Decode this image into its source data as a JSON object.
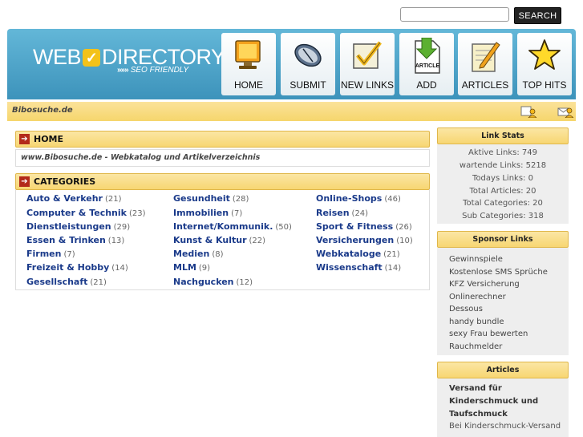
{
  "search": {
    "placeholder": "",
    "button_label": "SEARCH"
  },
  "logo": {
    "left": "WEB",
    "right": "DIRECTORY",
    "tagline_arrows": "»»»",
    "tagline": "SEO FRIENDLY"
  },
  "nav": [
    {
      "label": "HOME",
      "icon": "monitor-icon"
    },
    {
      "label": "SUBMIT",
      "icon": "mouse-icon"
    },
    {
      "label": "NEW LINKS",
      "icon": "checkmark-icon"
    },
    {
      "label": "ADD",
      "icon": "article-download-icon",
      "icon_text": "ARTICLE"
    },
    {
      "label": "ARTICLES",
      "icon": "notepad-pencil-icon"
    },
    {
      "label": "TOP HITS",
      "icon": "star-icon"
    }
  ],
  "site_name": "Bibosuche.de",
  "home_panel": {
    "title": "HOME",
    "text": "www.Bibosuche.de - Webkatalog und Artikelverzeichnis"
  },
  "categories_panel": {
    "title": "CATEGORIES",
    "items": [
      {
        "name": "Auto & Verkehr",
        "count": "(21)"
      },
      {
        "name": "Computer & Technik",
        "count": "(23)"
      },
      {
        "name": "Dienstleistungen",
        "count": "(29)"
      },
      {
        "name": "Essen & Trinken",
        "count": "(13)"
      },
      {
        "name": "Firmen",
        "count": "(7)"
      },
      {
        "name": "Freizeit & Hobby",
        "count": "(14)"
      },
      {
        "name": "Gesellschaft",
        "count": "(21)"
      },
      {
        "name": "Gesundheit",
        "count": "(28)"
      },
      {
        "name": "Immobilien",
        "count": "(7)"
      },
      {
        "name": "Internet/Kommunik.",
        "count": "(50)"
      },
      {
        "name": "Kunst & Kultur",
        "count": "(22)"
      },
      {
        "name": "Medien",
        "count": "(8)"
      },
      {
        "name": "MLM",
        "count": "(9)"
      },
      {
        "name": "Nachgucken",
        "count": "(12)"
      },
      {
        "name": "Online-Shops",
        "count": "(46)"
      },
      {
        "name": "Reisen",
        "count": "(24)"
      },
      {
        "name": "Sport & Fitness",
        "count": "(26)"
      },
      {
        "name": "Versicherungen",
        "count": "(10)"
      },
      {
        "name": "Webkataloge",
        "count": "(21)"
      },
      {
        "name": "Wissenschaft",
        "count": "(14)"
      }
    ]
  },
  "link_stats": {
    "title": "Link Stats",
    "lines": [
      "Aktive Links: 749",
      "wartende Links: 5218",
      "Todays Links: 0",
      "Total Articles: 20",
      "Total Categories: 20",
      "Sub Categories: 318"
    ]
  },
  "sponsor_links": {
    "title": "Sponsor Links",
    "items": [
      "Gewinnspiele",
      "Kostenlose SMS Sprüche",
      "KFZ Versicherung",
      "Onlinerechner",
      "Dessous",
      "handy bundle",
      "sexy Frau bewerten",
      "Rauchmelder"
    ]
  },
  "articles": {
    "title": "Articles",
    "item_title": "Versand für Kinderschmuck und Taufschmuck",
    "snippet": "Bei Kinderschmuck-Versand"
  },
  "colors": {
    "header_blue": "#4aa3c9",
    "bar_yellow": "#f8dc7e",
    "category_link": "#1a3a8a",
    "arrow_red": "#b32a1a"
  }
}
